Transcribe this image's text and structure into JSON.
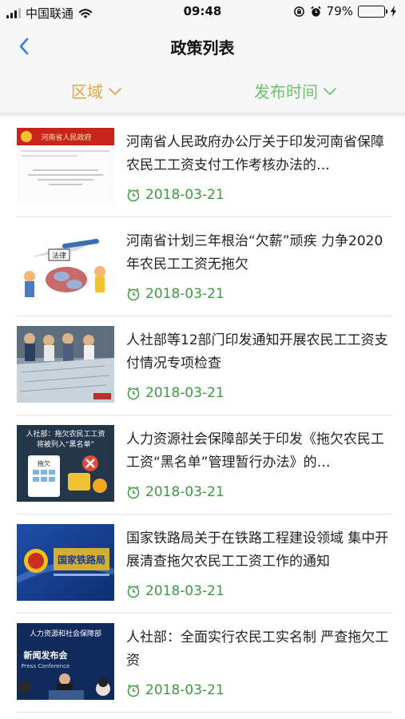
{
  "status_bar": {
    "carrier": "中国联通",
    "time": "09:48",
    "battery_percent": "79%",
    "battery_level": 0.79
  },
  "nav": {
    "title": "政策列表",
    "back_icon": "chevron-left-icon"
  },
  "filters": {
    "region_label": "区域",
    "time_label": "发布时间",
    "region_color": "#e0a64a",
    "time_color": "#6cc36c"
  },
  "accent_date_color": "#3f9a3f",
  "news": [
    {
      "title": "河南省人民政府办公厅关于印发河南省保障农民工工资支付工作考核办法的…",
      "date": "2018-03-21",
      "thumb_header": "河南省人民政府"
    },
    {
      "title": "河南省计划三年根治“欠薪”顽疾 力争2020年农民工工资无拖欠",
      "date": "2018-03-21",
      "thumb_label": "法律"
    },
    {
      "title": "人社部等12部门印发通知开展农民工工资支付情况专项检查",
      "date": "2018-03-21"
    },
    {
      "title": "人力资源社会保障部关于印发《拖欠农民工工资“黑名单”管理暂行办法》的…",
      "date": "2018-03-21",
      "thumb_line1": "人社部：拖欠农民工工资",
      "thumb_line2": "将被列入“黑名单”",
      "thumb_card": "拖欠"
    },
    {
      "title": "国家铁路局关于在铁路工程建设领域 集中开展清查拖欠农民工工资工作的通知",
      "date": "2018-03-21",
      "thumb_sign": "国家铁路局"
    },
    {
      "title": "人社部：全面实行农民工实名制 严查拖欠工资",
      "date": "2018-03-21",
      "thumb_line1": "人力资源和社会保障部",
      "thumb_line2": "新闻发布会",
      "thumb_line3": "Press Conference"
    }
  ]
}
